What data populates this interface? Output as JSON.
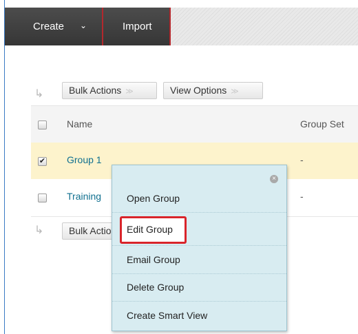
{
  "toolbar": {
    "create_label": "Create",
    "create_chevron": "⌄",
    "import_label": "Import"
  },
  "actions": {
    "bulk_actions": "Bulk Actions",
    "view_options": "View Options",
    "dropdown_glyph": "≫"
  },
  "table": {
    "headers": {
      "name": "Name",
      "group_set": "Group Set"
    },
    "rows": [
      {
        "name": "Group 1",
        "group_set": "-",
        "checked": true
      },
      {
        "name": "Training",
        "group_set": "-",
        "checked": false
      }
    ]
  },
  "context_menu": {
    "close_glyph": "×",
    "items": [
      "Open Group",
      "Edit Group",
      "Email Group",
      "Delete Group",
      "Create Smart View"
    ],
    "highlighted": "Edit Group"
  },
  "colors": {
    "toolbar_bg": "#3f3f3f",
    "accent_red": "#b3282d",
    "selected_row": "#fdf3cc",
    "menu_bg": "#d8ecf1",
    "link": "#0f6f8f"
  }
}
